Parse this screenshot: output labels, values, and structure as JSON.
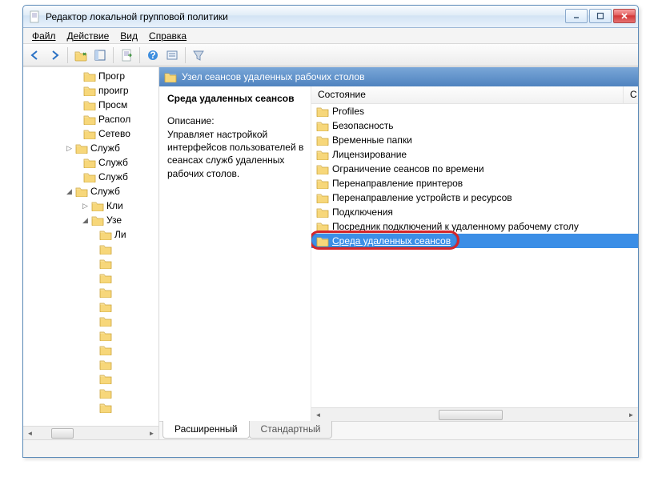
{
  "window": {
    "title": "Редактор локальной групповой политики"
  },
  "menu": {
    "file": "Файл",
    "action": "Действие",
    "view": "Вид",
    "help": "Справка"
  },
  "toolbar_icons": [
    "back",
    "forward",
    "up",
    "tree-toggle",
    "refresh",
    "export",
    "help",
    "props",
    "filter"
  ],
  "tree": {
    "items": [
      {
        "indent": 6,
        "label": "Прогр",
        "toggle": ""
      },
      {
        "indent": 6,
        "label": "проигр",
        "toggle": ""
      },
      {
        "indent": 6,
        "label": "Просм",
        "toggle": ""
      },
      {
        "indent": 6,
        "label": "Распол",
        "toggle": ""
      },
      {
        "indent": 6,
        "label": "Сетево",
        "toggle": ""
      },
      {
        "indent": 5,
        "label": "Служб",
        "toggle": "▷"
      },
      {
        "indent": 6,
        "label": "Служб",
        "toggle": ""
      },
      {
        "indent": 6,
        "label": "Служб",
        "toggle": ""
      },
      {
        "indent": 5,
        "label": "Служб",
        "toggle": "◢"
      },
      {
        "indent": 7,
        "label": "Кли",
        "toggle": "▷"
      },
      {
        "indent": 7,
        "label": "Узе",
        "toggle": "◢"
      },
      {
        "indent": 8,
        "label": "Ли",
        "toggle": ""
      },
      {
        "indent": 8,
        "label": "",
        "toggle": ""
      },
      {
        "indent": 8,
        "label": "",
        "toggle": ""
      },
      {
        "indent": 8,
        "label": "",
        "toggle": ""
      },
      {
        "indent": 8,
        "label": "",
        "toggle": ""
      },
      {
        "indent": 8,
        "label": "",
        "toggle": ""
      },
      {
        "indent": 8,
        "label": "",
        "toggle": ""
      },
      {
        "indent": 8,
        "label": "",
        "toggle": ""
      },
      {
        "indent": 8,
        "label": "",
        "toggle": ""
      },
      {
        "indent": 8,
        "label": "",
        "toggle": ""
      },
      {
        "indent": 8,
        "label": "",
        "toggle": ""
      },
      {
        "indent": 8,
        "label": "",
        "toggle": ""
      },
      {
        "indent": 8,
        "label": "",
        "toggle": ""
      }
    ]
  },
  "pathbar": {
    "label": "Узел сеансов удаленных рабочих столов"
  },
  "desc": {
    "title": "Среда удаленных сеансов",
    "caption": "Описание:",
    "text": "Управляет настройкой интерфейсов пользователей в сеансах служб удаленных рабочих столов."
  },
  "list": {
    "col0": "Состояние",
    "col1": "С",
    "items": [
      "Profiles",
      "Безопасность",
      "Временные папки",
      "Лицензирование",
      "Ограничение сеансов по времени",
      "Перенаправление принтеров",
      "Перенаправление устройств и ресурсов",
      "Подключения",
      "Посредник подключений к удаленному рабочему столу",
      "Среда удаленных сеансов"
    ],
    "selected_index": 9
  },
  "tabs": {
    "extended": "Расширенный",
    "standard": "Стандартный"
  }
}
